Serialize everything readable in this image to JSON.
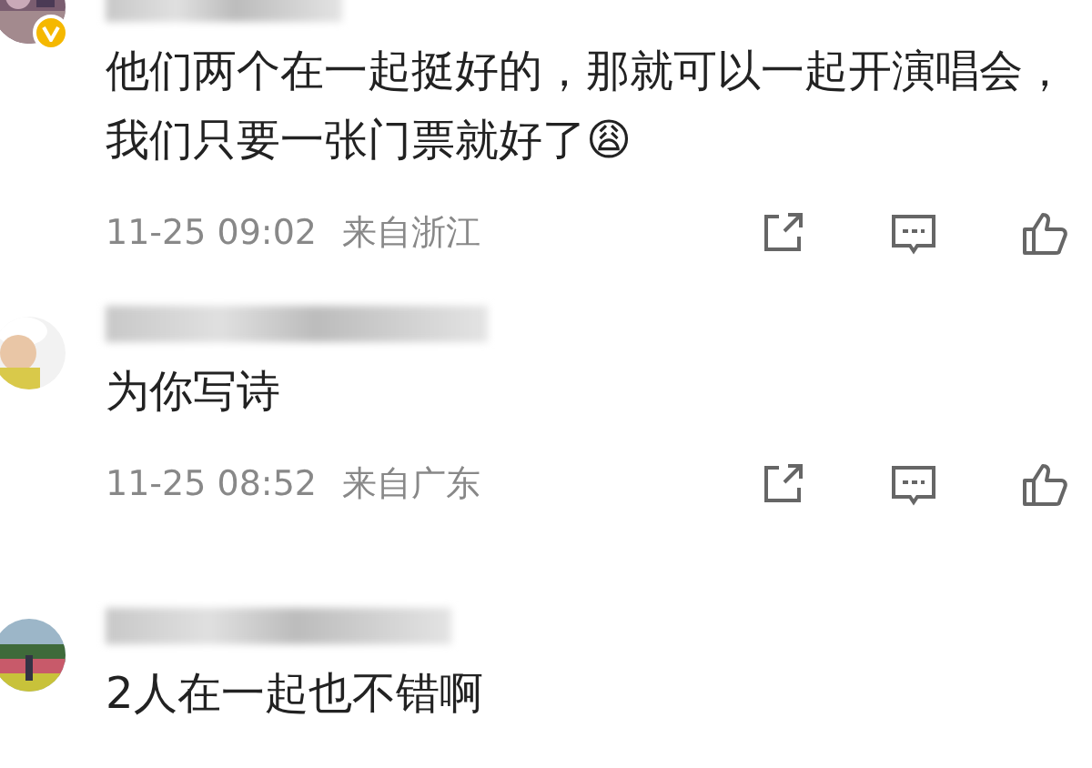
{
  "comments": [
    {
      "verified": true,
      "name_blurred": true,
      "text": "他们两个在一起挺好的，那就可以一起开演唱会，我们只要一张门票就好了😩",
      "time": "11-25 09:02",
      "location": "来自浙江"
    },
    {
      "verified": false,
      "name_blurred": true,
      "text": "为你写诗",
      "time": "11-25 08:52",
      "location": "来自广东"
    },
    {
      "verified": false,
      "name_blurred": true,
      "text": "2人在一起也不错啊"
    }
  ]
}
